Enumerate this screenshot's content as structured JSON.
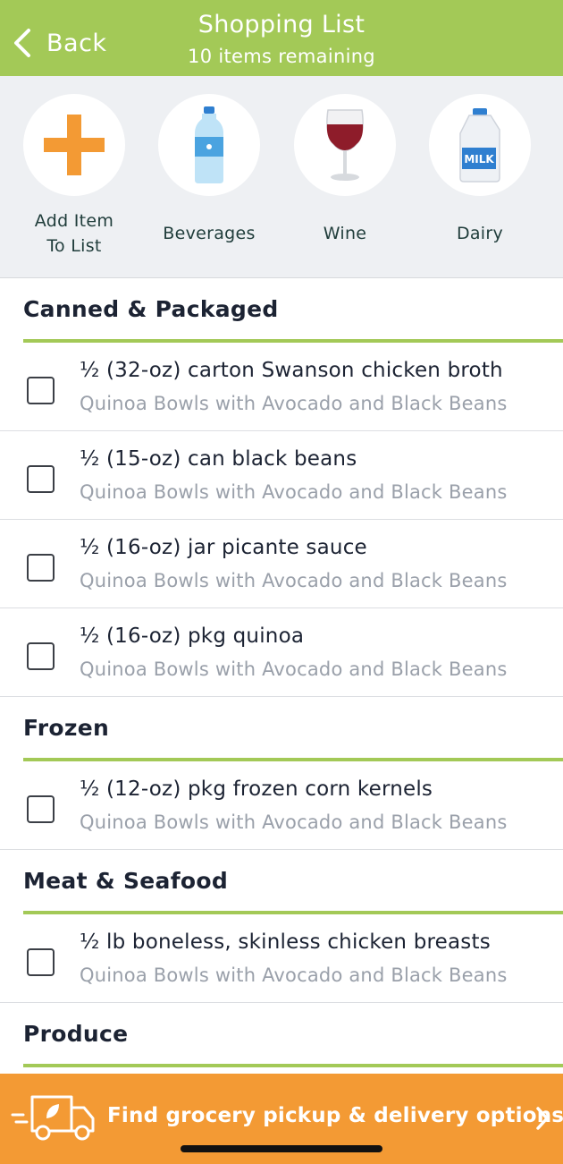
{
  "header": {
    "back_label": "Back",
    "title": "Shopping List",
    "subtitle": "10 items remaining",
    "color": "#a3c957"
  },
  "categories": [
    {
      "label_line1": "Add Item",
      "label_line2": "To List",
      "icon": "plus-icon"
    },
    {
      "label": "Beverages",
      "icon": "water-bottle-icon"
    },
    {
      "label": "Wine",
      "icon": "wine-glass-icon"
    },
    {
      "label": "Dairy",
      "icon": "milk-jug-icon",
      "icon_text": "MILK"
    }
  ],
  "sections": [
    {
      "title": "Canned & Packaged",
      "items": [
        {
          "name": "½ (32-oz) carton Swanson chicken broth",
          "recipe": "Quinoa Bowls with Avocado and Black Beans",
          "checked": false
        },
        {
          "name": "½ (15-oz) can black beans",
          "recipe": "Quinoa Bowls with Avocado and Black Beans",
          "checked": false
        },
        {
          "name": "½ (16-oz) jar picante sauce",
          "recipe": "Quinoa Bowls with Avocado and Black Beans",
          "checked": false
        },
        {
          "name": "½ (16-oz) pkg quinoa",
          "recipe": "Quinoa Bowls with Avocado and Black Beans",
          "checked": false
        }
      ]
    },
    {
      "title": "Frozen",
      "items": [
        {
          "name": "½ (12-oz) pkg frozen corn kernels",
          "recipe": "Quinoa Bowls with Avocado and Black Beans",
          "checked": false
        }
      ]
    },
    {
      "title": "Meat & Seafood",
      "items": [
        {
          "name": "½ lb boneless, skinless chicken breasts",
          "recipe": "Quinoa Bowls with Avocado and Black Beans",
          "checked": false
        }
      ]
    },
    {
      "title": "Produce",
      "items": []
    }
  ],
  "banner": {
    "label": "Find grocery pickup & delivery options",
    "color": "#f39a34",
    "icon": "delivery-truck-icon"
  }
}
